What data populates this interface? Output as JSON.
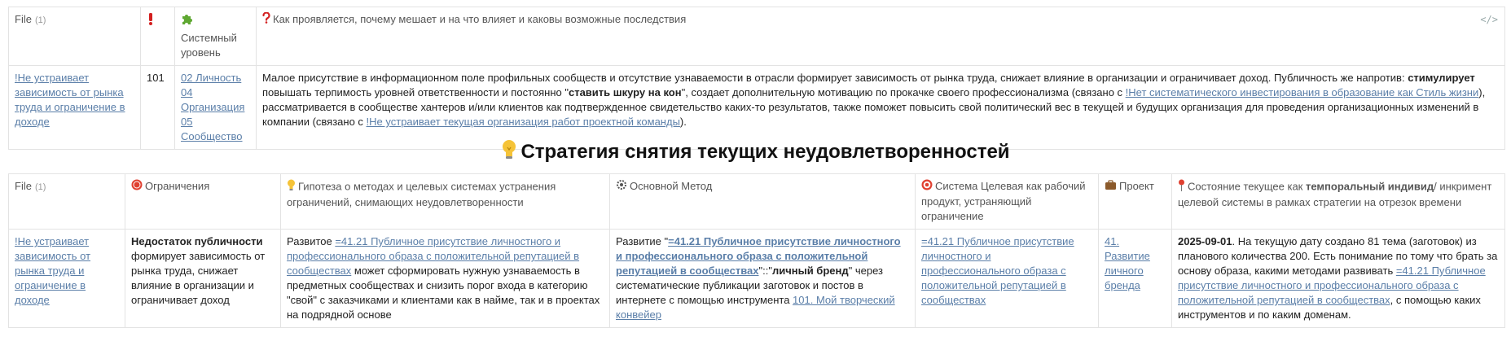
{
  "table1": {
    "headers": {
      "file": "File",
      "file_count": "(1)",
      "system_level": "Системный уровень",
      "manifest": "Как проявляется, почему мешает и на что влияет и каковы возможные последствия"
    },
    "row": {
      "file_link": "!Не устраивает зависимость от рынка труда и ограничение в доходе",
      "number": "101",
      "levels": [
        "02 Личность",
        "04 Организация",
        "05 Сообщество"
      ],
      "desc_1": "Малое присутствие в информационном поле профильных сообществ и отсутствие узнаваемости в отрасли формирует зависимость от рынка труда, снижает влияние в организации и ограничивает доход. Публичность же напротив: ",
      "desc_b1": "стимулирует",
      "desc_2": " повышать терпимость уровней ответственности и постоянно \"",
      "desc_b2": "ставить шкуру на кон",
      "desc_3": "\", создает дополнительную мотивацию по прокачке своего профессионализма (связано с ",
      "desc_link1": "!Нет систематического инвестирования в образование как Стиль жизни",
      "desc_4": "), рассматривается в сообществе хантеров и/или клиентов как подтвержденное свидетельство каких-то результатов, также поможет повысить свой политический вес в текущей и будущих организация для проведения организационных изменений в компании (связано с ",
      "desc_link2": "!Не устраивает текущая организация работ проектной команды",
      "desc_5": ")."
    }
  },
  "heading": "Стратегия снятия текущих неудовлетворенностей",
  "table2": {
    "headers": {
      "file": "File",
      "file_count": "(1)",
      "limits": "Ограничения",
      "hypothesis": "Гипотеза о методах и целевых системах устранения ограничений, снимающих неудовлетворенности",
      "method": "Основной Метод",
      "target": "Система Целевая как рабочий продукт, устраняющий ограничение",
      "project": "Проект",
      "state_1": "Состояние текущее как ",
      "state_b": "темпоральный индивид",
      "state_2": "/ инкримент целевой системы в рамках стратегии на отрезок времени"
    },
    "row": {
      "file_link": "!Не устраивает зависимость от рынка труда и ограничение в доходе",
      "limit_b": "Недостаток публичности",
      "limit_text": " формирует зависимость от рынка труда, снижает влияние в организации и ограничивает доход",
      "hyp_1": "Развитое ",
      "hyp_link": "=41.21 Публичное присутствие личностного и профессионального образа с положительной репутацией в сообществах",
      "hyp_2": " может сформировать нужную узнаваемость в предметных сообществах и снизить порог входа в категорию \"свой\" с заказчиками и клиентами как в найме, так и в проектах на подрядной основе",
      "method_1": "Развитие \"",
      "method_link": "=41.21 Публичное присутствие личностного и профессионального образа с положительной репутацией в сообществах",
      "method_2": "\"::\"",
      "method_b": "личный бренд",
      "method_3": "\" через систематические публикации заготовок и постов в интернете с помощью инструмента ",
      "method_link2": "101. Мой творческий конвейер",
      "target_link": "=41.21 Публичное присутствие личностного и профессионального образа с положительной репутацией в сообществах",
      "project_link": "41. Развитие личного бренда",
      "state_date": "2025-09-01",
      "state_1": ". На текущую дату создано 81 тема (заготовок) из планового количества 200. Есть понимание по тому что брать за основу образа, какими методами развивать ",
      "state_link": "=41.21 Публичное присутствие личностного и профессионального образа с положительной репутацией в сообществах",
      "state_2": ", с помощью каких инструментов и по каким доменам."
    }
  },
  "icons": {
    "exclamation": "exclamation-icon",
    "puzzle": "puzzle-icon",
    "question": "question-icon",
    "bulb": "lightbulb-icon",
    "stop": "stop-icon",
    "gear": "gear-icon",
    "target": "target-icon",
    "briefcase": "briefcase-icon",
    "pin": "pin-icon",
    "code": "code-icon"
  },
  "colors": {
    "link": "#5a7ea8",
    "border": "#e3e3e3",
    "red": "#d32020",
    "green": "#5fa832"
  }
}
